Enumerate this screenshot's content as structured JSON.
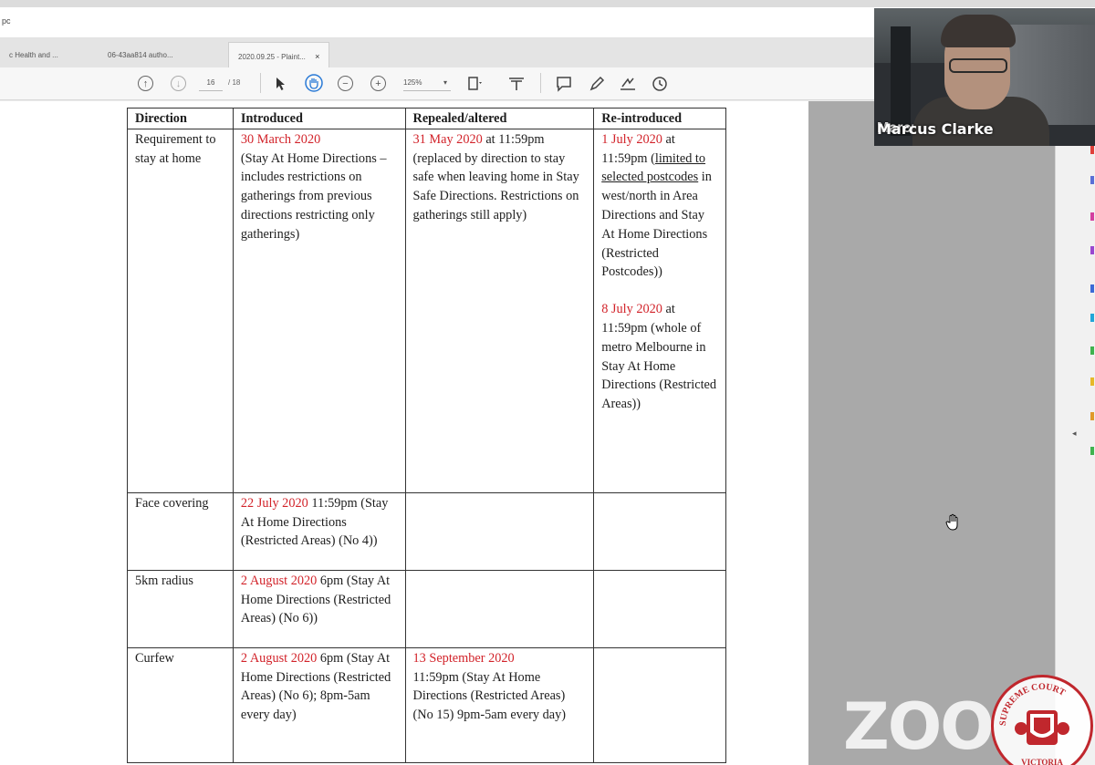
{
  "browser": {
    "url_fragment": "pc",
    "tabs": [
      {
        "label": "c Health and ..."
      },
      {
        "label": "06-43aa814 autho..."
      },
      {
        "label": "2020.09.25 - Plaint...",
        "close": "×"
      }
    ]
  },
  "toolbar": {
    "page_current": "16",
    "page_total": "/ 18",
    "zoom": "125%"
  },
  "table": {
    "headers": [
      "Direction",
      "Introduced",
      "Repealed/altered",
      "Re-introduced"
    ],
    "rows": {
      "stay_home": {
        "direction": "Requirement to stay at home",
        "intro_date": "30 March 2020",
        "intro_rest": "(Stay At Home Directions – includes restrictions on gatherings from previous directions restricting only gatherings)",
        "rep_date": "31 May 2020",
        "rep_rest": " at 11:59pm (replaced by direction to stay safe when leaving home in Stay Safe Directions. Restrictions on gatherings still apply)",
        "re1_date": "1 July 2020",
        "re1_a": " at 11:59pm (",
        "re1_ul": "limited to selected postcodes",
        "re1_b": " in west/north in Area Directions and Stay At Home Directions (Restricted Postcodes))",
        "re2_date": "8 July 2020",
        "re2_rest": " at 11:59pm (whole of metro Melbourne in Stay At Home Directions (Restricted Areas))"
      },
      "face": {
        "direction": "Face covering",
        "intro_date": "22 July 2020",
        "intro_rest": " 11:59pm (Stay At Home Directions (Restricted Areas) (No 4))"
      },
      "radius": {
        "direction": "5km radius",
        "intro_date": "2 August 2020",
        "intro_rest": " 6pm (Stay At Home Directions (Restricted Areas) (No 6))"
      },
      "curfew": {
        "direction": "Curfew",
        "intro_date": "2 August 2020",
        "intro_rest": " 6pm (Stay At Home Directions (Restricted Areas) (No 6); 8pm-5am every day)",
        "rep_date": "13 September 2020",
        "rep_rest": " 11:59pm (Stay At Home Directions (Restricted Areas) (No 15) 9pm-5am every day)"
      }
    }
  },
  "video": {
    "participant_name": "Marcus Clarke"
  },
  "watermark": "ZOO",
  "seal_text": "SUPREME COURT VICTORIA",
  "colors": {
    "date_red": "#d2232a",
    "hand_tool_blue": "#2a7ad6",
    "seal_red": "#c0272d"
  }
}
